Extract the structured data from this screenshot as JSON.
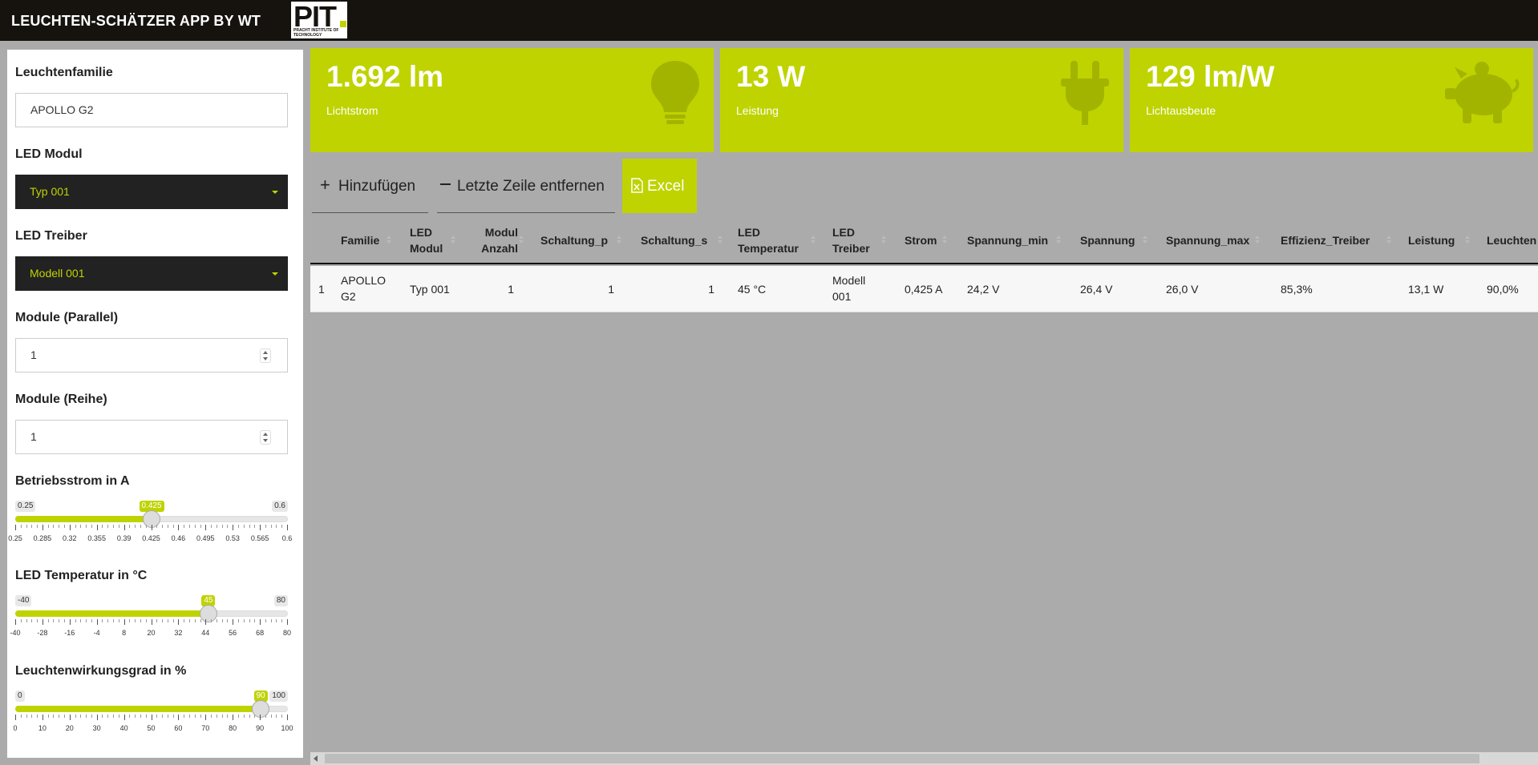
{
  "header": {
    "title": "LEUCHTEN-SCHÄTZER APP BY WT",
    "logo_main": "PIT",
    "logo_sub": "PRACHT INSTITUTE OF TECHNOLOGY"
  },
  "sidebar": {
    "family": {
      "label": "Leuchtenfamilie",
      "value": "APOLLO G2"
    },
    "led_module": {
      "label": "LED Modul",
      "value": "Typ 001"
    },
    "led_driver": {
      "label": "LED Treiber",
      "value": "Modell 001"
    },
    "modules_parallel": {
      "label": "Module (Parallel)",
      "value": "1"
    },
    "modules_series": {
      "label": "Module (Reihe)",
      "value": "1"
    },
    "current": {
      "label": "Betriebsstrom in A",
      "min": "0.25",
      "max": "0.6",
      "value": "0.425",
      "fraction": 0.5,
      "ticks": [
        "0.25",
        "0.285",
        "0.32",
        "0.355",
        "0.39",
        "0.425",
        "0.46",
        "0.495",
        "0.53",
        "0.565",
        "0.6"
      ]
    },
    "temperature": {
      "label": "LED Temperatur in °C",
      "min": "-40",
      "max": "80",
      "value": "45",
      "fraction": 0.7083,
      "ticks": [
        "-40",
        "-28",
        "-16",
        "-4",
        "8",
        "20",
        "32",
        "44",
        "56",
        "68",
        "80"
      ]
    },
    "efficiency": {
      "label": "Leuchtenwirkungsgrad in %",
      "min": "0",
      "max": "100",
      "value": "90",
      "fraction": 0.9,
      "ticks": [
        "0",
        "10",
        "20",
        "30",
        "40",
        "50",
        "60",
        "70",
        "80",
        "90",
        "100"
      ]
    }
  },
  "value_boxes": [
    {
      "value": "1.692 lm",
      "caption": "Lichtstrom",
      "icon": "lightbulb-icon"
    },
    {
      "value": "13 W",
      "caption": "Leistung",
      "icon": "plug-icon"
    },
    {
      "value": "129 lm/W",
      "caption": "Lichtausbeute",
      "icon": "piggy-bank-icon"
    }
  ],
  "actions": {
    "add": "Hinzufügen",
    "remove": "Letzte Zeile entfernen",
    "excel": "Excel"
  },
  "table": {
    "headers": [
      "Familie",
      "LED Modul",
      "Modul Anzahl",
      "Schaltung_p",
      "Schaltung_s",
      "LED Temperatur",
      "LED Treiber",
      "Strom",
      "Spannung_min",
      "Spannung",
      "Spannung_max",
      "Effizienz_Treiber",
      "Leistung",
      "Leuchten"
    ],
    "rows": [
      [
        "1",
        "APOLLO G2",
        "Typ 001",
        "1",
        "1",
        "1",
        "45 °C",
        "Modell 001",
        "0,425 A",
        "24,2 V",
        "26,4 V",
        "26,0 V",
        "85,3%",
        "13,1 W",
        "90,0%"
      ]
    ]
  },
  "colors": {
    "accent": "#bfd300",
    "header_bg": "#16130f",
    "page_bg": "#ababab"
  }
}
